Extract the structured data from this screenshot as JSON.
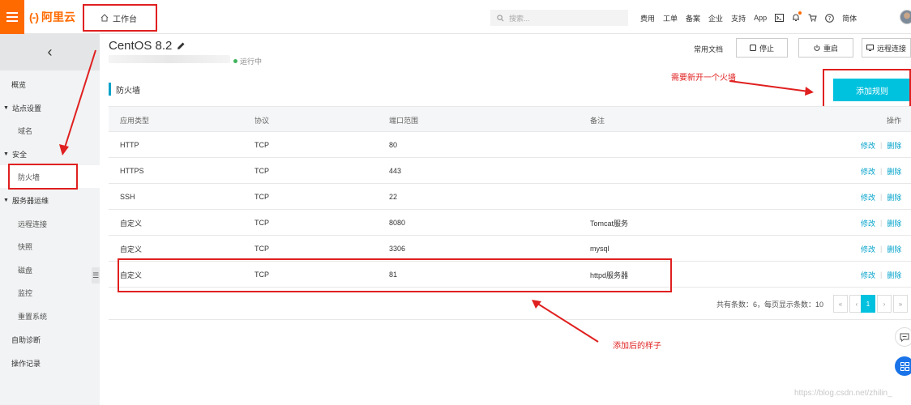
{
  "topbar": {
    "logo_text": "阿里云",
    "logo_bracket": "(-)",
    "workbench_label": "工作台",
    "search_placeholder": "搜索...",
    "nav_links": [
      "费用",
      "工单",
      "备案",
      "企业",
      "支持",
      "App"
    ],
    "lang_label": "简体"
  },
  "sidebar": {
    "items": [
      {
        "label": "概览",
        "level": 1
      },
      {
        "label": "站点设置",
        "level": 1,
        "caret": "▼"
      },
      {
        "label": "域名",
        "level": 2
      },
      {
        "label": "安全",
        "level": 1,
        "caret": "▼"
      },
      {
        "label": "防火墙",
        "level": 2,
        "active": true
      },
      {
        "label": "服务器运维",
        "level": 1,
        "caret": "▼"
      },
      {
        "label": "远程连接",
        "level": 2
      },
      {
        "label": "快照",
        "level": 2
      },
      {
        "label": "磁盘",
        "level": 2
      },
      {
        "label": "监控",
        "level": 2
      },
      {
        "label": "重置系统",
        "level": 2
      },
      {
        "label": "自助诊断",
        "level": 1
      },
      {
        "label": "操作记录",
        "level": 1
      }
    ]
  },
  "header": {
    "instance_title": "CentOS 8.2",
    "status": "运行中",
    "docs_link": "常用文档",
    "stop_label": "停止",
    "restart_label": "重启",
    "remote_label": "远程连接"
  },
  "section": {
    "title": "防火墙",
    "add_rule_label": "添加规则"
  },
  "annotations": {
    "top": "需要新开一个火墙",
    "bottom": "添加后的样子"
  },
  "table": {
    "headers": [
      "应用类型",
      "协议",
      "端口范围",
      "备注",
      "操作"
    ],
    "rows": [
      [
        "HTTP",
        "TCP",
        "80",
        ""
      ],
      [
        "HTTPS",
        "TCP",
        "443",
        ""
      ],
      [
        "SSH",
        "TCP",
        "22",
        ""
      ],
      [
        "自定义",
        "TCP",
        "8080",
        "Tomcat服务"
      ],
      [
        "自定义",
        "TCP",
        "3306",
        "mysql"
      ],
      [
        "自定义",
        "TCP",
        "81",
        "httpd服务器"
      ]
    ],
    "edit_label": "修改",
    "delete_label": "删除",
    "pager_text": "共有条数：6，每页显示条数：10",
    "pager_buttons": [
      "«",
      "‹",
      "1",
      "›",
      "»"
    ],
    "current_page": "1"
  },
  "watermark": "https://blog.csdn.net/zhilin_"
}
